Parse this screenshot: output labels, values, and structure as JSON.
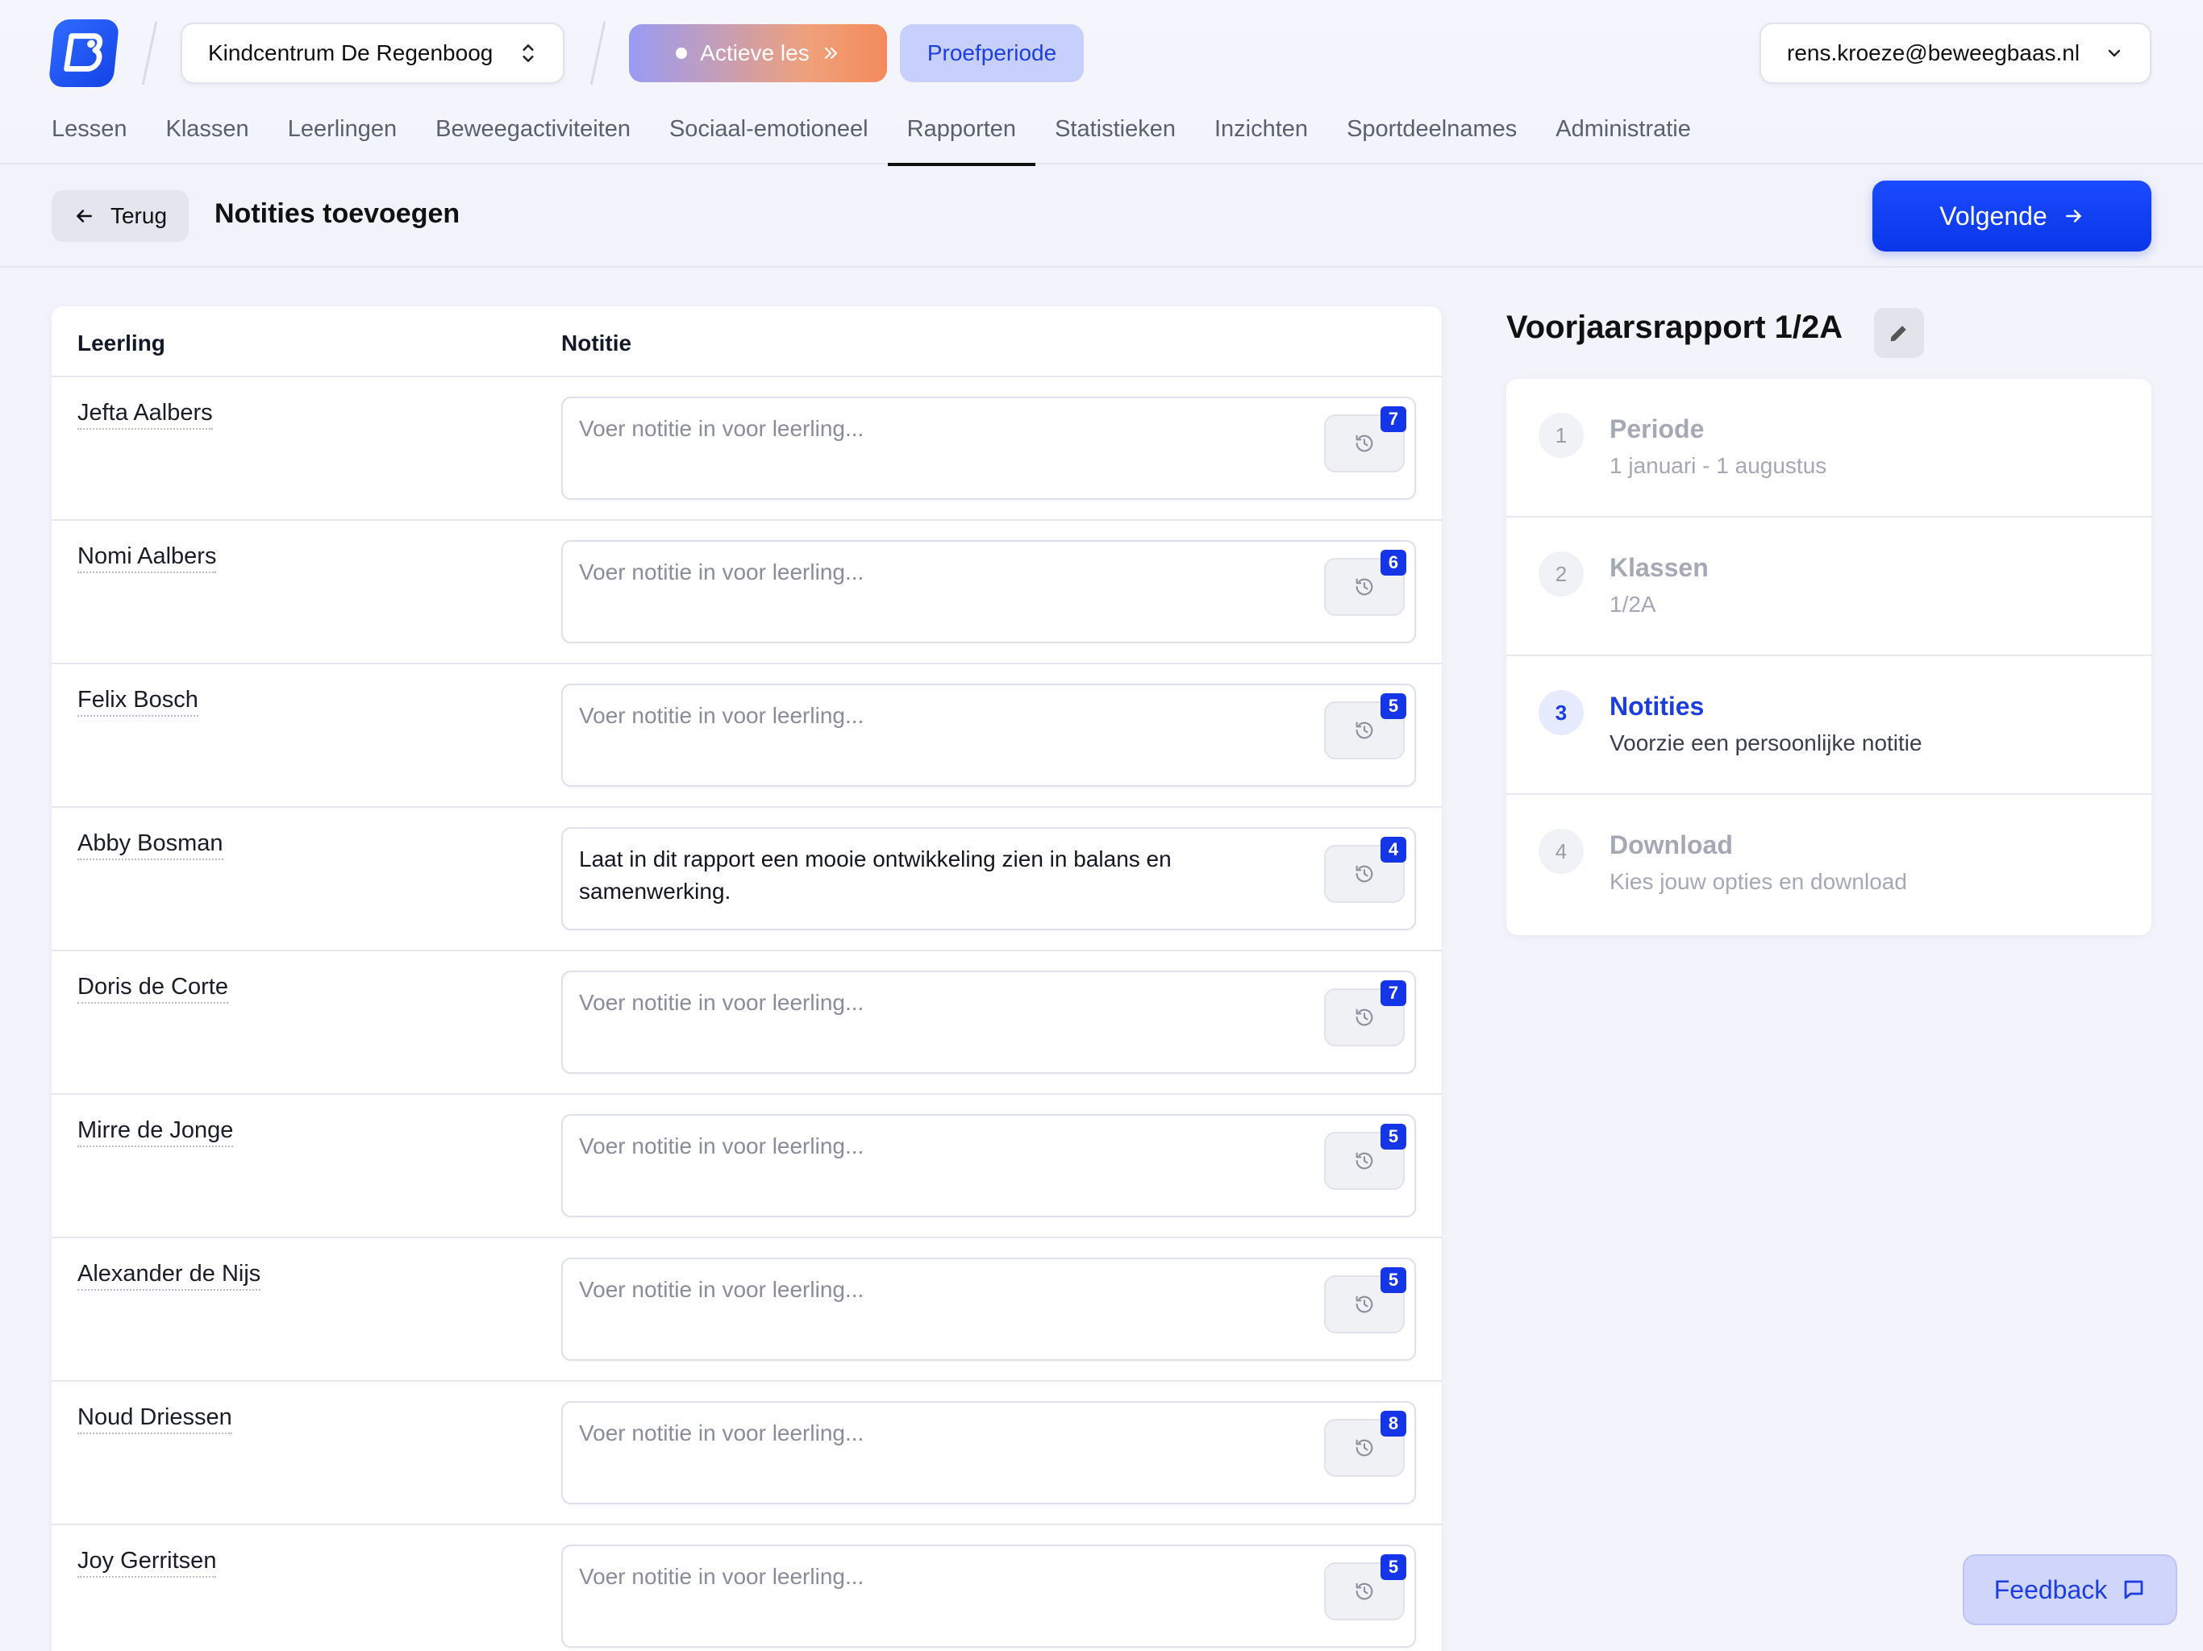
{
  "header": {
    "school": "Kindcentrum De Regenboog",
    "active_lesson": "Actieve les",
    "trial": "Proefperiode",
    "user_email": "rens.kroeze@beweegbaas.nl",
    "nav": [
      {
        "label": "Lessen"
      },
      {
        "label": "Klassen"
      },
      {
        "label": "Leerlingen"
      },
      {
        "label": "Beweegactiviteiten"
      },
      {
        "label": "Sociaal-emotioneel"
      },
      {
        "label": "Rapporten",
        "active": true
      },
      {
        "label": "Statistieken"
      },
      {
        "label": "Inzichten"
      },
      {
        "label": "Sportdeelnames"
      },
      {
        "label": "Administratie"
      }
    ]
  },
  "subheader": {
    "back_label": "Terug",
    "title": "Notities toevoegen",
    "next_label": "Volgende"
  },
  "table": {
    "col_student": "Leerling",
    "col_note": "Notitie",
    "placeholder": "Voer notitie in voor leerling...",
    "rows": [
      {
        "name": "Jefta Aalbers",
        "note": "",
        "count": "7"
      },
      {
        "name": "Nomi Aalbers",
        "note": "",
        "count": "6"
      },
      {
        "name": "Felix Bosch",
        "note": "",
        "count": "5"
      },
      {
        "name": "Abby Bosman",
        "note": "Laat in dit rapport een mooie ontwikkeling zien in balans en samenwerking.",
        "count": "4"
      },
      {
        "name": "Doris de Corte",
        "note": "",
        "count": "7"
      },
      {
        "name": "Mirre de Jonge",
        "note": "",
        "count": "5"
      },
      {
        "name": "Alexander de Nijs",
        "note": "",
        "count": "5"
      },
      {
        "name": "Noud Driessen",
        "note": "",
        "count": "8"
      },
      {
        "name": "Joy Gerritsen",
        "note": "",
        "count": "5"
      }
    ]
  },
  "report": {
    "title": "Voorjaarsrapport 1/2A",
    "steps": [
      {
        "num": "1",
        "title": "Periode",
        "sub": "1 januari - 1 augustus"
      },
      {
        "num": "2",
        "title": "Klassen",
        "sub": "1/2A"
      },
      {
        "num": "3",
        "title": "Notities",
        "sub": "Voorzie een persoonlijke notitie",
        "active": true
      },
      {
        "num": "4",
        "title": "Download",
        "sub": "Kies jouw opties en download"
      }
    ]
  },
  "feedback_label": "Feedback",
  "colors": {
    "primary": "#1436e8",
    "trial_bg": "#c7cffc",
    "active_gradient_start": "#9a9bf4",
    "active_gradient_end": "#f48a5c"
  }
}
